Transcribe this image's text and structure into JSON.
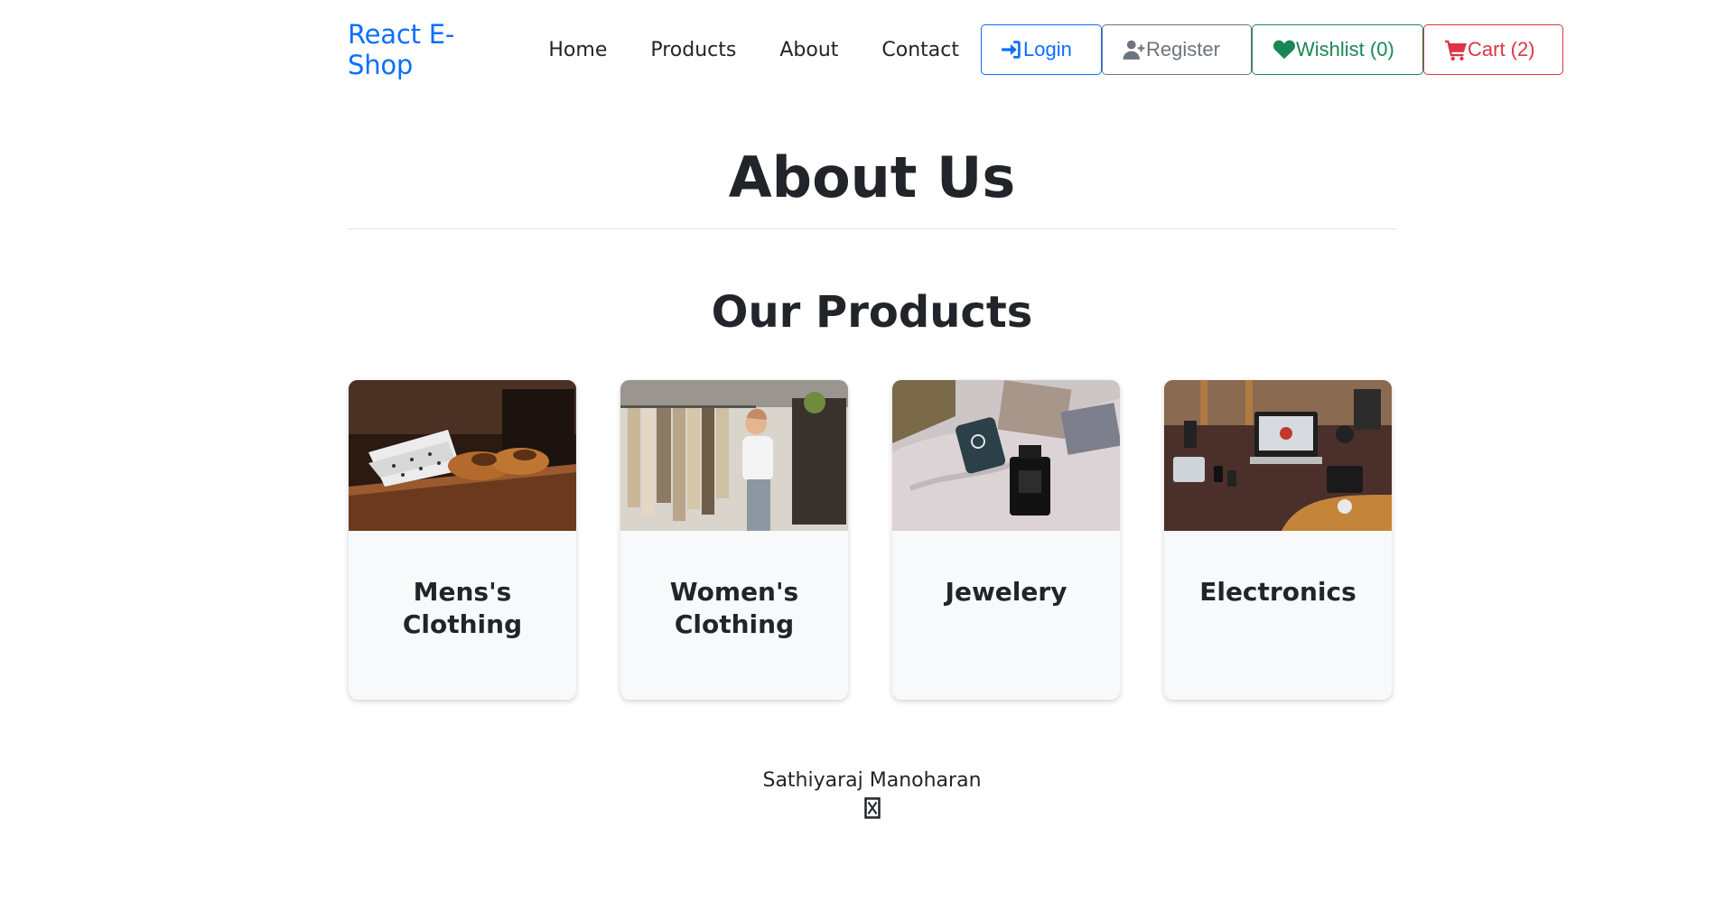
{
  "nav": {
    "brand": "React E-Shop",
    "links": [
      "Home",
      "Products",
      "About",
      "Contact"
    ],
    "login_label": "Login",
    "register_label": "Register",
    "wishlist_label": "Wishlist (0)",
    "cart_label": "Cart (2)",
    "icons": {
      "login": "sign-in-icon",
      "register": "user-plus-icon",
      "wishlist": "heart-icon",
      "cart": "cart-icon"
    }
  },
  "page": {
    "title": "About Us",
    "section_title": "Our Products"
  },
  "products": [
    {
      "title": "Mens's Clothing"
    },
    {
      "title": "Women's Clothing"
    },
    {
      "title": "Jewelery"
    },
    {
      "title": "Electronics"
    }
  ],
  "footer": {
    "name": "Sathiyaraj Manoharan",
    "icon": "missing-glyph-icon"
  },
  "colors": {
    "primary": "#0d6efd",
    "secondary": "#6c757d",
    "success": "#198754",
    "danger": "#dc3545",
    "text": "#212529"
  }
}
